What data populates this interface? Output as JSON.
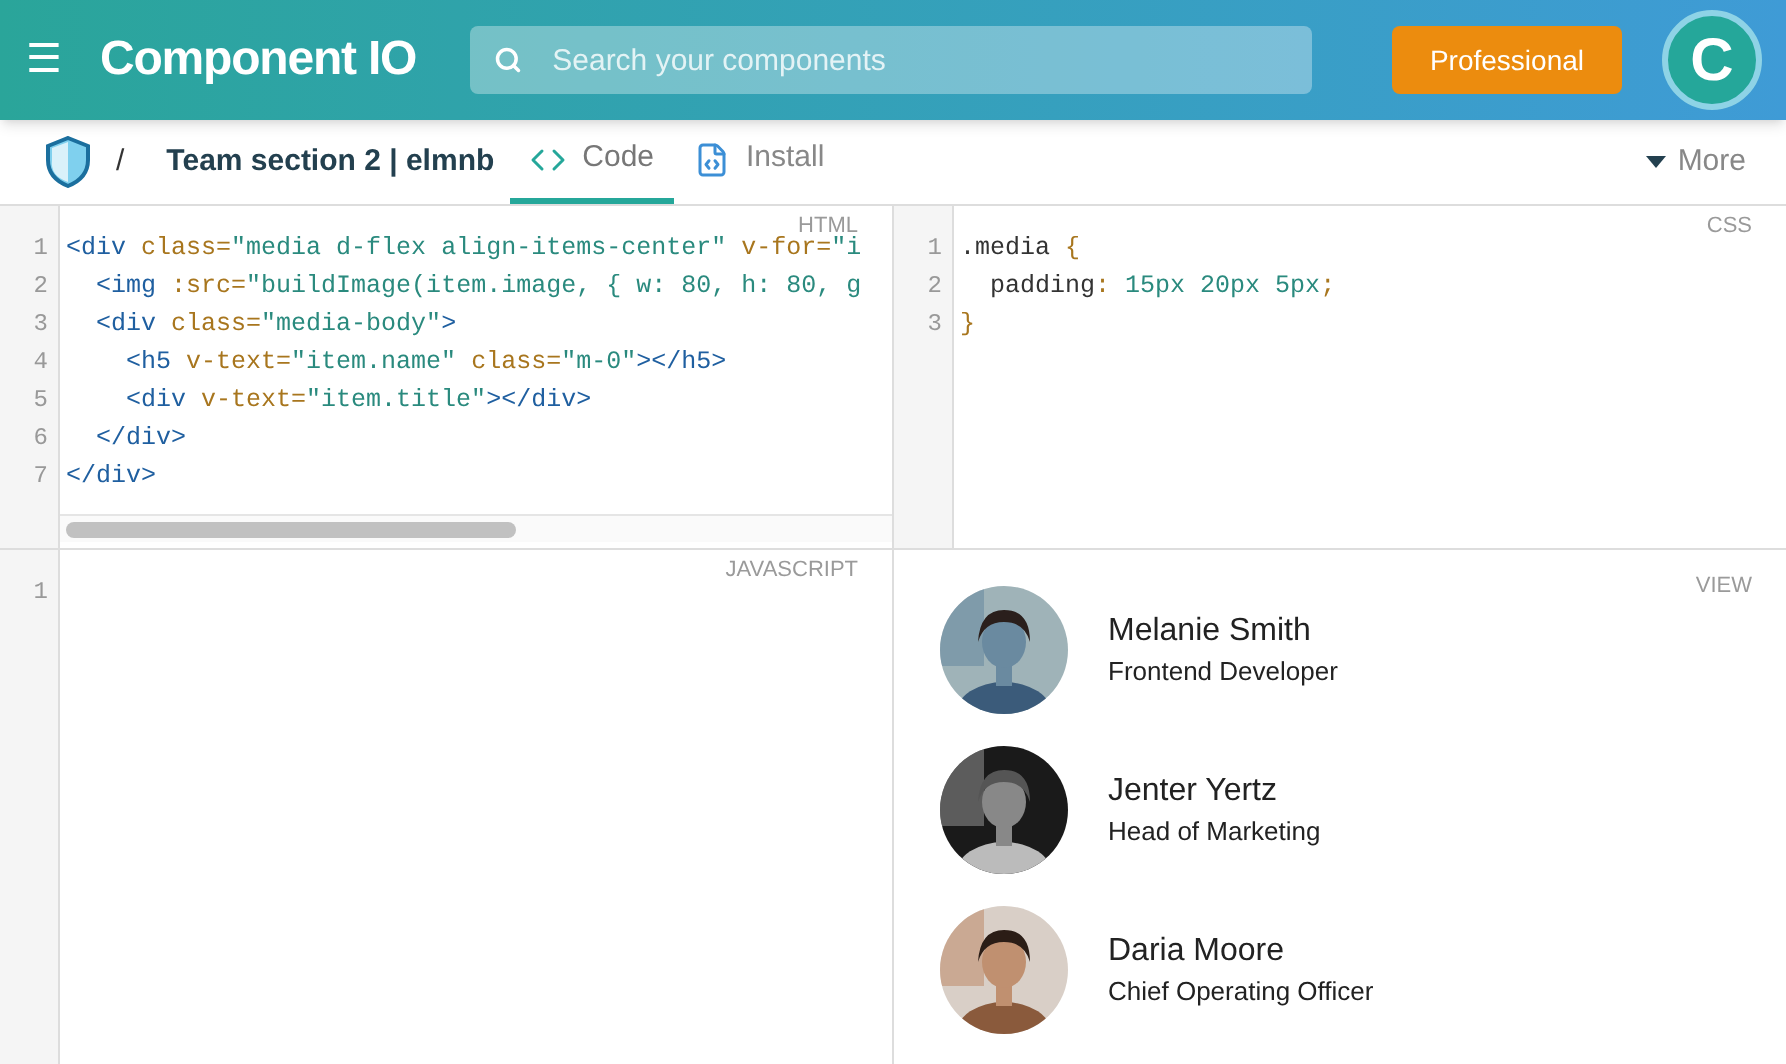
{
  "header": {
    "menu_glyph": "☰",
    "logo": "Component IO",
    "search": {
      "placeholder": "Search your components"
    },
    "plan_button": "Professional",
    "avatar_letter": "C"
  },
  "toolbar": {
    "separator": "/",
    "title": "Team section 2 | elmnb",
    "tabs": [
      {
        "label": "Code",
        "selected": true
      },
      {
        "label": "Install",
        "selected": false
      }
    ],
    "more": "More"
  },
  "panes": [
    {
      "label": "HTML",
      "kind": "code",
      "lines": [
        {
          "number": "1",
          "tokens": [
            {
              "t": "<div ",
              "kind": "tag"
            },
            {
              "t": "class",
              "kind": "attr"
            },
            {
              "t": "=",
              "kind": "punct"
            },
            {
              "t": "\"media d-flex align-items-center\"",
              "kind": "string"
            },
            {
              "t": " v-for=",
              "kind": "attr"
            },
            {
              "t": "\"i",
              "kind": "string"
            }
          ]
        },
        {
          "number": "2",
          "tokens": [
            {
              "t": "  <img ",
              "kind": "tag"
            },
            {
              "t": ":src",
              "kind": "attr"
            },
            {
              "t": "=",
              "kind": "punct"
            },
            {
              "t": "\"buildImage(item.image, { w: 80, h: 80, g",
              "kind": "string"
            }
          ]
        },
        {
          "number": "3",
          "tokens": [
            {
              "t": "  <div ",
              "kind": "tag"
            },
            {
              "t": "class",
              "kind": "attr"
            },
            {
              "t": "=",
              "kind": "punct"
            },
            {
              "t": "\"media-body\"",
              "kind": "string"
            },
            {
              "t": ">",
              "kind": "tag"
            }
          ]
        },
        {
          "number": "4",
          "tokens": [
            {
              "t": "    <h5 ",
              "kind": "tag"
            },
            {
              "t": "v-text",
              "kind": "attr"
            },
            {
              "t": "=",
              "kind": "punct"
            },
            {
              "t": "\"item.name\" ",
              "kind": "string"
            },
            {
              "t": "class",
              "kind": "attr"
            },
            {
              "t": "=",
              "kind": "punct"
            },
            {
              "t": "\"m-0\"",
              "kind": "string"
            },
            {
              "t": "></h5>",
              "kind": "tag"
            }
          ]
        },
        {
          "number": "5",
          "tokens": [
            {
              "t": "    <div ",
              "kind": "tag"
            },
            {
              "t": "v-text",
              "kind": "attr"
            },
            {
              "t": "=",
              "kind": "punct"
            },
            {
              "t": "\"item.title\"",
              "kind": "string"
            },
            {
              "t": "></div>",
              "kind": "tag"
            }
          ]
        },
        {
          "number": "6",
          "tokens": [
            {
              "t": "  </div>",
              "kind": "tag"
            }
          ]
        },
        {
          "number": "7",
          "tokens": [
            {
              "t": "</div>",
              "kind": "tag"
            }
          ]
        }
      ]
    },
    {
      "label": "CSS",
      "kind": "code",
      "lines": [
        {
          "number": "1",
          "tokens": [
            {
              "t": ".media ",
              "kind": "plain"
            },
            {
              "t": "{",
              "kind": "attr"
            }
          ]
        },
        {
          "number": "2",
          "tokens": [
            {
              "t": "  padding",
              "kind": "plain"
            },
            {
              "t": ": ",
              "kind": "attr"
            },
            {
              "t": "15px 20px 5px",
              "kind": "string"
            },
            {
              "t": ";",
              "kind": "attr"
            }
          ]
        },
        {
          "number": "3",
          "tokens": [
            {
              "t": "}",
              "kind": "attr"
            }
          ]
        }
      ]
    },
    {
      "label": "JAVASCRIPT",
      "kind": "code",
      "lines": [
        {
          "number": "1"
        }
      ]
    },
    {
      "label": "VIEW",
      "kind": "view",
      "people": [
        {
          "name": "Melanie Smith",
          "title": "Frontend Developer"
        },
        {
          "name": "Jenter Yertz",
          "title": "Head of Marketing"
        },
        {
          "name": "Daria Moore",
          "title": "Chief Operating Officer"
        }
      ]
    }
  ]
}
